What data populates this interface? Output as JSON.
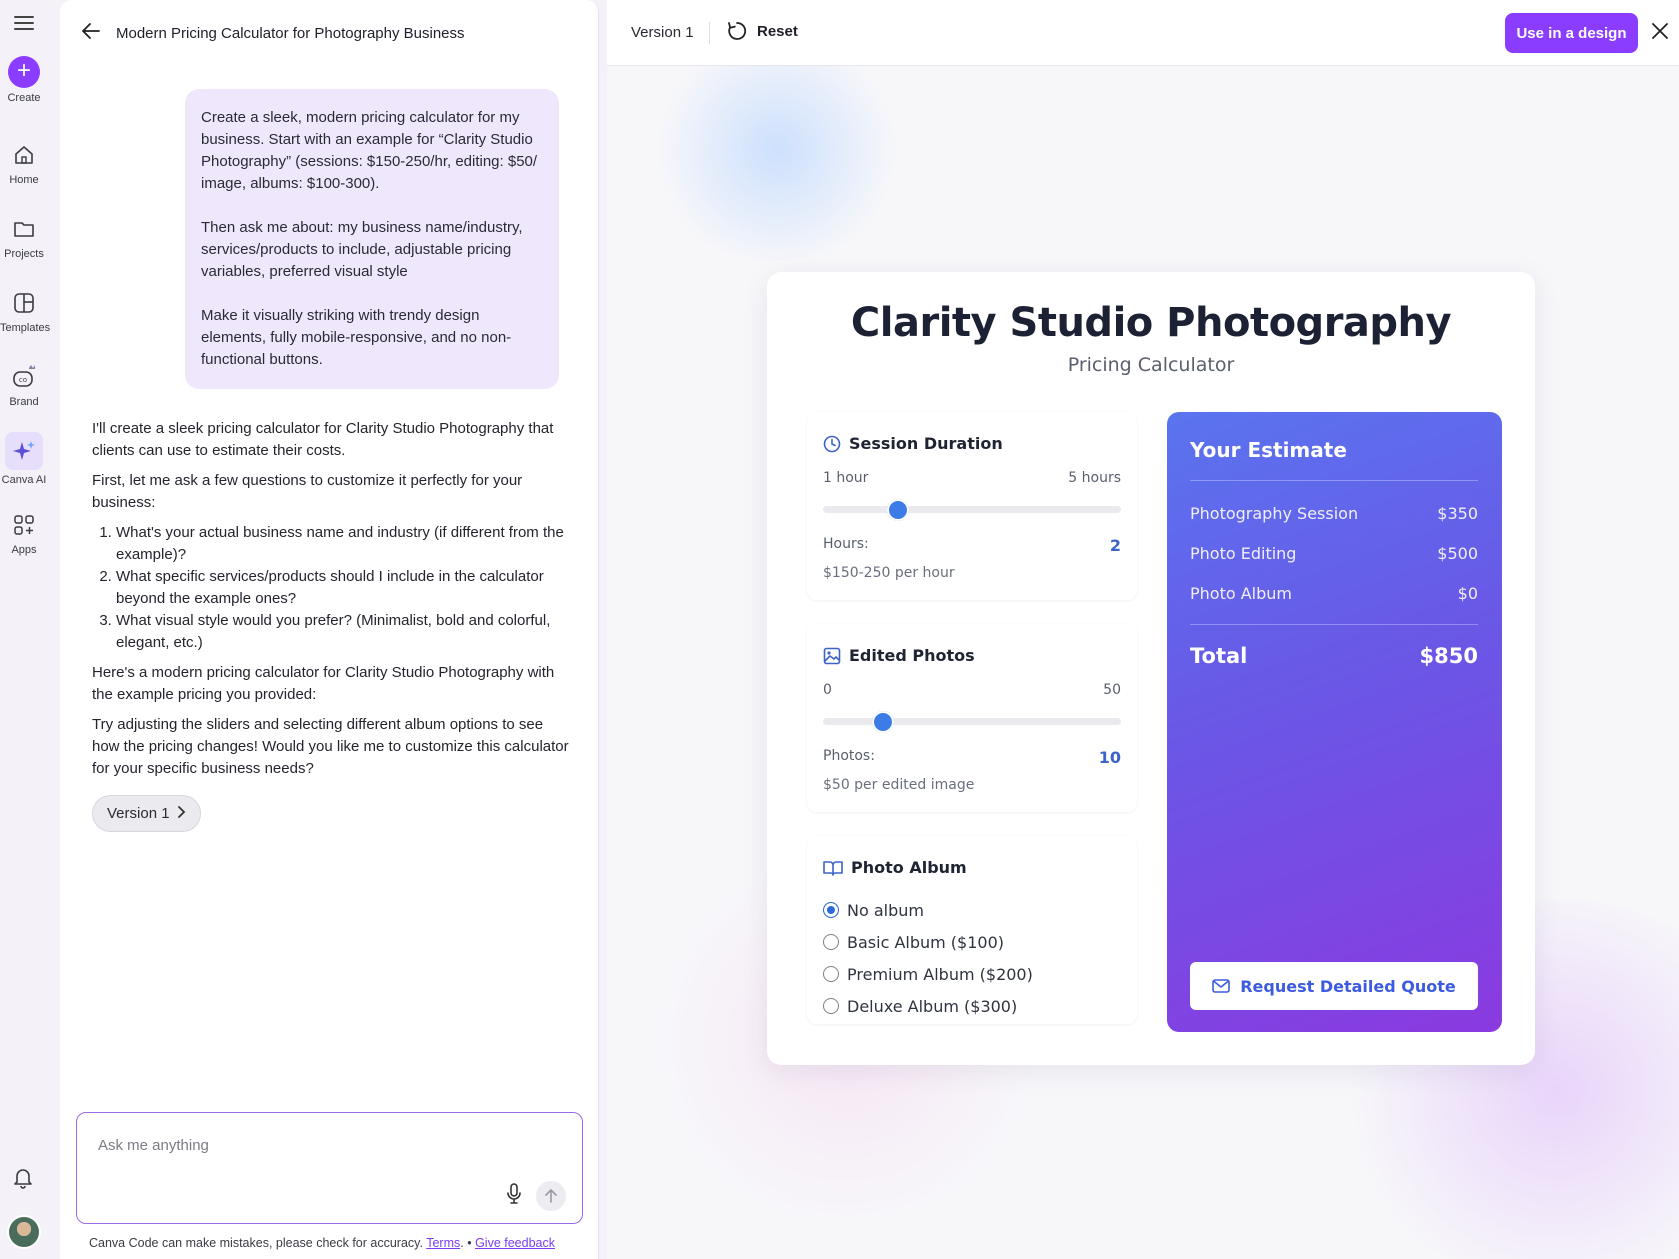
{
  "rail": {
    "create": "Create",
    "items": [
      "Home",
      "Projects",
      "Templates",
      "Brand",
      "Canva AI",
      "Apps"
    ]
  },
  "chat": {
    "title": "Modern Pricing Calculator for Photography Business",
    "user_message": [
      "Create a sleek, modern pricing calculator for my business. Start with an example for “Clarity Studio Photography” (sessions: $150-250/hr, editing: $50/ image, albums: $100-300).",
      "Then ask me about: my business name/industry, services/products to include, adjustable pricing variables, preferred visual style",
      "Make it visually striking with trendy design elements, fully mobile-responsive, and no non-functional buttons."
    ],
    "assistant": {
      "p1": "I'll create a sleek pricing calculator for Clarity Studio Photography that clients can use to estimate their costs.",
      "p2": "First, let me ask a few questions to customize it perfectly for your business:",
      "questions": [
        "What's your actual business name and industry (if different from the example)?",
        "What specific services/products should I include in the calculator beyond the example ones?",
        "What visual style would you prefer? (Minimalist, bold and colorful, elegant, etc.)"
      ],
      "p3": "Here's a modern pricing calculator for Clarity Studio Photography with the example pricing you provided:",
      "p4": "Try adjusting the sliders and selecting different album options to see how the pricing changes! Would you like me to customize this calculator for your specific business needs?"
    },
    "version_chip": "Version 1",
    "input_placeholder": "Ask me anything",
    "disclaimer": "Canva Code can make mistakes, please check for accuracy.",
    "terms_link": "Terms",
    "bullet": "•",
    "feedback_link": "Give feedback"
  },
  "preview": {
    "version_label": "Version 1",
    "reset_label": "Reset",
    "use_button": "Use in a design",
    "accent": "#8b3dff"
  },
  "calculator": {
    "title": "Clarity Studio Photography",
    "subtitle": "Pricing Calculator",
    "session": {
      "heading": "Session Duration",
      "min_label": "1 hour",
      "max_label": "5 hours",
      "min": 1,
      "max": 5,
      "value": 2,
      "value_label": "Hours:",
      "value_text": "2",
      "rate": "$150-250 per hour"
    },
    "photos": {
      "heading": "Edited Photos",
      "min_label": "0",
      "max_label": "50",
      "min": 0,
      "max": 50,
      "value": 10,
      "value_label": "Photos:",
      "value_text": "10",
      "rate": "$50 per edited image"
    },
    "album": {
      "heading": "Photo Album",
      "options": [
        "No album",
        "Basic Album ($100)",
        "Premium Album ($200)",
        "Deluxe Album ($300)"
      ],
      "selected": 0
    },
    "estimate": {
      "title": "Your Estimate",
      "rows": [
        {
          "label": "Photography Session",
          "value": "$350"
        },
        {
          "label": "Photo Editing",
          "value": "$500"
        },
        {
          "label": "Photo Album",
          "value": "$0"
        }
      ],
      "total_label": "Total",
      "total_value": "$850",
      "quote_button": "Request Detailed Quote"
    }
  }
}
